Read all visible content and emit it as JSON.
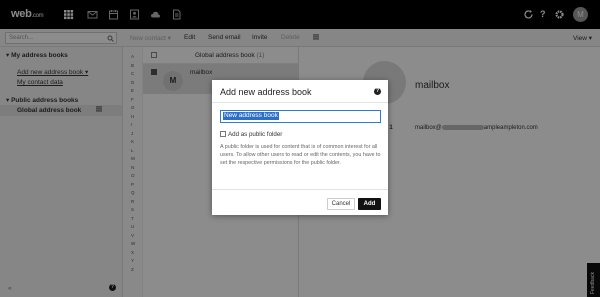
{
  "brand": {
    "logo_main": "web",
    "logo_suffix": ".com"
  },
  "topbar": {
    "avatar_initial": "M",
    "help_label": "?"
  },
  "toolbar": {
    "search_placeholder": "Search...",
    "new_contact": "New contact",
    "edit": "Edit",
    "send_email": "Send email",
    "invite": "Invite",
    "delete": "Delete",
    "view": "View"
  },
  "sidebar": {
    "my_books_header": "My address books",
    "add_new_book": "Add new address book",
    "my_contact_data": "My contact data",
    "public_books_header": "Public address books",
    "global_book": "Global address book",
    "bottom_help": "?"
  },
  "letters": [
    "A",
    "B",
    "C",
    "D",
    "E",
    "F",
    "G",
    "H",
    "I",
    "J",
    "K",
    "L",
    "M",
    "N",
    "O",
    "P",
    "Q",
    "R",
    "S",
    "T",
    "U",
    "V",
    "W",
    "X",
    "Y",
    "Z"
  ],
  "list": {
    "header_label": "Global address book",
    "header_count": "(1)",
    "row_name": "mailbox",
    "row_initial": "M"
  },
  "detail": {
    "name": "mailbox",
    "email_label": "ail 1",
    "email_prefix": "mailbox@",
    "email_suffix": "ampleampleton.com",
    "feedback": "Feedback"
  },
  "dialog": {
    "title": "Add new address book",
    "help": "?",
    "input_value": "New address book",
    "checkbox_label": "Add as public folder",
    "description": "A public folder is used for content that is of common interest for all users. To allow other users to read or edit the contents, you have to set the respective permissions for the public folder.",
    "cancel": "Cancel",
    "add": "Add"
  }
}
